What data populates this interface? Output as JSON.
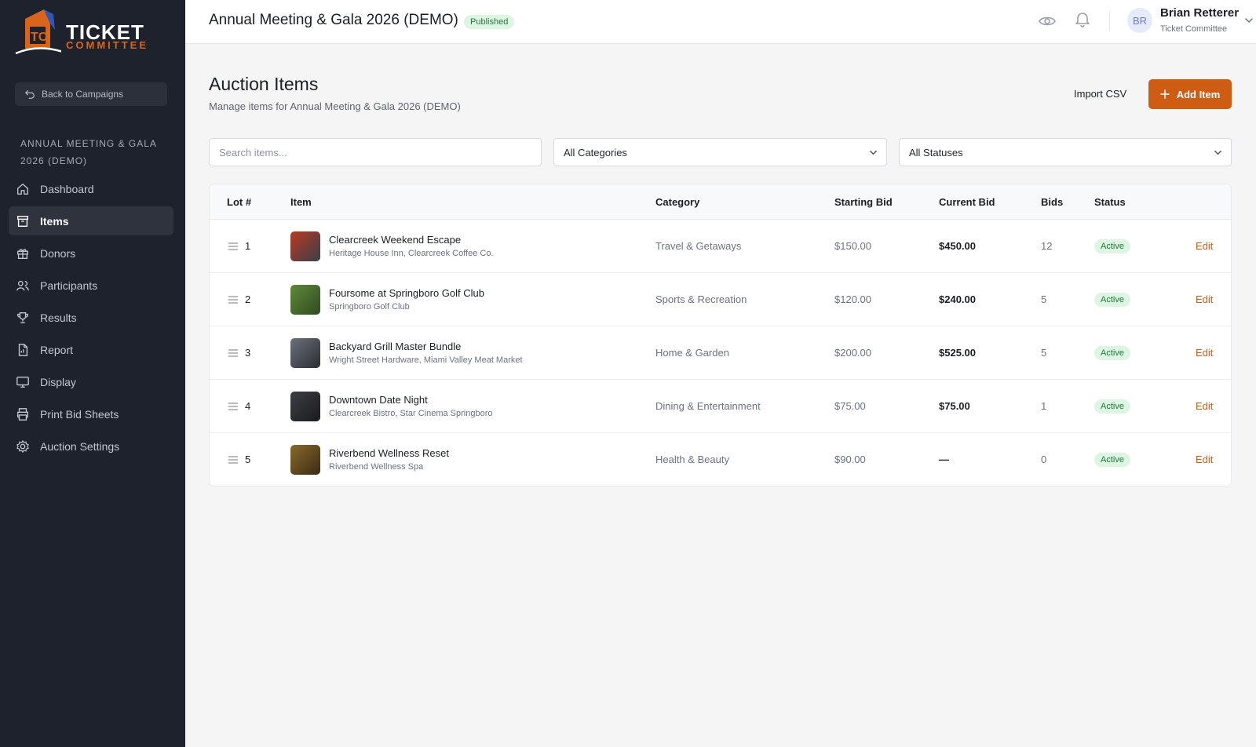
{
  "sidebar": {
    "logo": {
      "line1": "TICKET",
      "line2": "COMMITTEE"
    },
    "back_label": "Back to Campaigns",
    "campaign_name": "ANNUAL MEETING & GALA 2026 (DEMO)",
    "items": [
      {
        "label": "Dashboard",
        "icon": "home-icon"
      },
      {
        "label": "Items",
        "icon": "archive-icon"
      },
      {
        "label": "Donors",
        "icon": "gift-icon"
      },
      {
        "label": "Participants",
        "icon": "users-icon"
      },
      {
        "label": "Results",
        "icon": "trophy-icon"
      },
      {
        "label": "Report",
        "icon": "document-icon"
      },
      {
        "label": "Display",
        "icon": "monitor-icon"
      },
      {
        "label": "Print Bid Sheets",
        "icon": "printer-icon"
      },
      {
        "label": "Auction Settings",
        "icon": "gear-icon"
      }
    ],
    "active_item": "Items"
  },
  "header": {
    "title": "Annual Meeting & Gala 2026 (DEMO)",
    "badge": "Published",
    "user": {
      "initials": "BR",
      "name": "Brian Retterer",
      "role": "Ticket Committee"
    }
  },
  "page": {
    "title": "Auction Items",
    "subtitle": "Manage items for Annual Meeting & Gala 2026 (DEMO)",
    "import_label": "Import CSV",
    "add_label": "Add Item"
  },
  "filters": {
    "search_placeholder": "Search items...",
    "category": "All Categories",
    "status": "All Statuses"
  },
  "table": {
    "columns": {
      "lot": "Lot #",
      "item": "Item",
      "category": "Category",
      "starting": "Starting Bid",
      "current": "Current Bid",
      "bids": "Bids",
      "status": "Status"
    },
    "rows": [
      {
        "lot": "1",
        "name": "Clearcreek Weekend Escape",
        "donors": "Heritage House Inn, Clearcreek Coffee Co.",
        "category": "Travel & Getaways",
        "starting": "$150.00",
        "current": "$450.00",
        "bids": "12",
        "status": "Active",
        "edit": "Edit",
        "thumb_colors": [
          "#b93a22",
          "#3a3f4a"
        ]
      },
      {
        "lot": "2",
        "name": "Foursome at Springboro Golf Club",
        "donors": "Springboro Golf Club",
        "category": "Sports & Recreation",
        "starting": "$120.00",
        "current": "$240.00",
        "bids": "5",
        "status": "Active",
        "edit": "Edit",
        "thumb_colors": [
          "#5f8a3a",
          "#2f4a22"
        ]
      },
      {
        "lot": "3",
        "name": "Backyard Grill Master Bundle",
        "donors": "Wright Street Hardware, Miami Valley Meat Market",
        "category": "Home & Garden",
        "starting": "$200.00",
        "current": "$525.00",
        "bids": "5",
        "status": "Active",
        "edit": "Edit",
        "thumb_colors": [
          "#6c707a",
          "#2a2d33"
        ]
      },
      {
        "lot": "4",
        "name": "Downtown Date Night",
        "donors": "Clearcreek Bistro, Star Cinema Springboro",
        "category": "Dining & Entertainment",
        "starting": "$75.00",
        "current": "$75.00",
        "bids": "1",
        "status": "Active",
        "edit": "Edit",
        "thumb_colors": [
          "#3d3f44",
          "#1a1b1e"
        ]
      },
      {
        "lot": "5",
        "name": "Riverbend Wellness Reset",
        "donors": "Riverbend Wellness Spa",
        "category": "Health & Beauty",
        "starting": "$90.00",
        "current": "—",
        "bids": "0",
        "status": "Active",
        "edit": "Edit",
        "thumb_colors": [
          "#8a6a2a",
          "#3a2a15"
        ]
      }
    ]
  },
  "colors": {
    "sidebar_bg": "#1e222c",
    "accent": "#cf5c13",
    "badge_bg": "#def5e3",
    "badge_text": "#1f7a3a"
  }
}
